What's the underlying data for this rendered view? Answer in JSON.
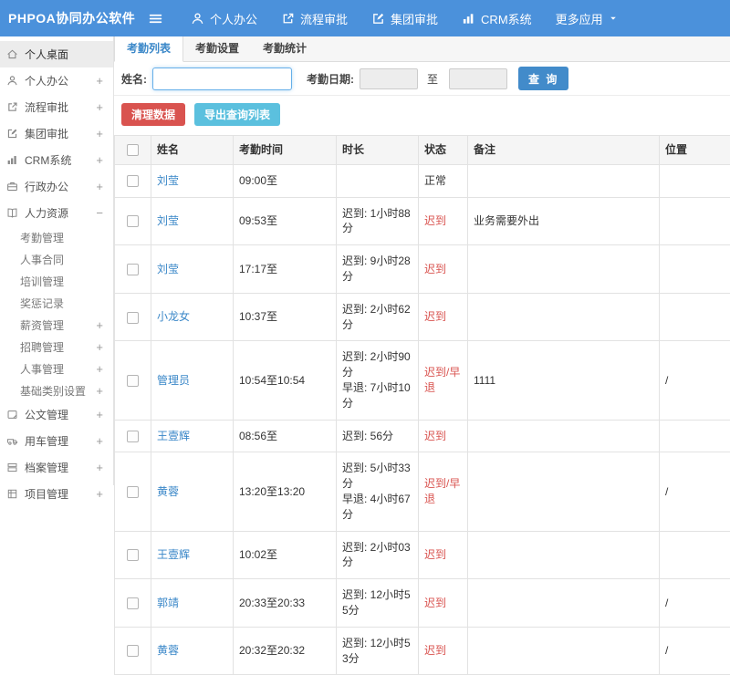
{
  "topbar": {
    "logo": "PHPOA协同办公软件",
    "nav": [
      {
        "id": "personal-office",
        "label": "个人办公",
        "icon": "user-icon"
      },
      {
        "id": "workflow-approval",
        "label": "流程审批",
        "icon": "share-icon"
      },
      {
        "id": "group-approval",
        "label": "集团审批",
        "icon": "edit-icon"
      },
      {
        "id": "crm-system",
        "label": "CRM系统",
        "icon": "chart-icon"
      },
      {
        "id": "more-apps",
        "label": "更多应用",
        "icon": "",
        "caret": true
      }
    ]
  },
  "sidebar": {
    "items": [
      {
        "id": "personal-desktop",
        "label": "个人桌面",
        "icon": "home-icon",
        "active": true
      },
      {
        "id": "personal-office",
        "label": "个人办公",
        "icon": "user-icon",
        "expand": "+"
      },
      {
        "id": "workflow-approval",
        "label": "流程审批",
        "icon": "share-icon",
        "expand": "+"
      },
      {
        "id": "group-approval",
        "label": "集团审批",
        "icon": "edit-icon",
        "expand": "+"
      },
      {
        "id": "crm-system",
        "label": "CRM系统",
        "icon": "chart-icon",
        "expand": "+"
      },
      {
        "id": "admin-office",
        "label": "行政办公",
        "icon": "briefcase-icon",
        "expand": "+"
      },
      {
        "id": "human-resources",
        "label": "人力资源",
        "icon": "book-icon",
        "expand": "-",
        "children": [
          {
            "id": "attendance-management",
            "label": "考勤管理"
          },
          {
            "id": "personnel-contract",
            "label": "人事合同"
          },
          {
            "id": "training-management",
            "label": "培训管理"
          },
          {
            "id": "reward-punishment",
            "label": "奖惩记录"
          },
          {
            "id": "salary-management",
            "label": "薪资管理",
            "expand": "+"
          },
          {
            "id": "recruitment-management",
            "label": "招聘管理",
            "expand": "+"
          },
          {
            "id": "personnel-management",
            "label": "人事管理",
            "expand": "+"
          },
          {
            "id": "basic-category-settings",
            "label": "基础类别设置",
            "expand": "+"
          }
        ]
      },
      {
        "id": "document-management",
        "label": "公文管理",
        "icon": "doc-icon",
        "expand": "+"
      },
      {
        "id": "vehicle-management",
        "label": "用车管理",
        "icon": "car-icon",
        "expand": "+"
      },
      {
        "id": "archive-management",
        "label": "档案管理",
        "icon": "archive-icon",
        "expand": "+"
      },
      {
        "id": "project-management",
        "label": "项目管理",
        "icon": "project-icon",
        "expand": "+"
      }
    ]
  },
  "tabs": [
    {
      "id": "attendance-list",
      "label": "考勤列表",
      "active": true
    },
    {
      "id": "attendance-settings",
      "label": "考勤设置"
    },
    {
      "id": "attendance-statistics",
      "label": "考勤统计"
    }
  ],
  "filter": {
    "name_label": "姓名:",
    "name_value": "",
    "date_label": "考勤日期:",
    "date_from_value": "",
    "to_label": "至",
    "date_to_value": "",
    "search_button": "查 询"
  },
  "actions": {
    "clear_button": "清理数据",
    "export_button": "导出查询列表"
  },
  "table": {
    "headers": [
      "姓名",
      "考勤时间",
      "时长",
      "状态",
      "备注",
      "位置"
    ],
    "rows": [
      {
        "name": "刘莹",
        "time": "09:00至",
        "duration": "",
        "status": "正常",
        "status_type": "normal",
        "note": "",
        "location": ""
      },
      {
        "name": "刘莹",
        "time": "09:53至",
        "duration": "迟到: 1小时88分",
        "status": "迟到",
        "status_type": "late",
        "note": "业务需要外出",
        "location": ""
      },
      {
        "name": "刘莹",
        "time": "17:17至",
        "duration": "迟到: 9小时28分",
        "status": "迟到",
        "status_type": "late",
        "note": "",
        "location": ""
      },
      {
        "name": "小龙女",
        "time": "10:37至",
        "duration": "迟到: 2小时62分",
        "status": "迟到",
        "status_type": "late",
        "note": "",
        "location": ""
      },
      {
        "name": "管理员",
        "time": "10:54至10:54",
        "duration": [
          "迟到: 2小时90分",
          "早退: 7小时10分"
        ],
        "status": "迟到/早退",
        "status_type": "late",
        "note": "1111",
        "location": "/"
      },
      {
        "name": "王壹辉",
        "time": "08:56至",
        "duration": "迟到: 56分",
        "status": "迟到",
        "status_type": "late",
        "note": "",
        "location": ""
      },
      {
        "name": "黄蓉",
        "time": "13:20至13:20",
        "duration": [
          "迟到: 5小时33分",
          "早退: 4小时67分"
        ],
        "status": "迟到/早退",
        "status_type": "late",
        "note": "",
        "location": "/"
      },
      {
        "name": "王壹辉",
        "time": "10:02至",
        "duration": "迟到: 2小时03分",
        "status": "迟到",
        "status_type": "late",
        "note": "",
        "location": ""
      },
      {
        "name": "郭靖",
        "time": "20:33至20:33",
        "duration": "迟到: 12小时55分",
        "status": "迟到",
        "status_type": "late",
        "note": "",
        "location": "/"
      },
      {
        "name": "黄蓉",
        "time": "20:32至20:32",
        "duration": "迟到: 12小时53分",
        "status": "迟到",
        "status_type": "late",
        "note": "",
        "location": "/"
      }
    ]
  },
  "colors": {
    "topbar_bg": "#4b91db",
    "accent_blue": "#428bca",
    "link_blue": "#3a87c8",
    "danger_red": "#d9534f",
    "info_cyan": "#5bc0de",
    "status_red": "#d9534f"
  }
}
